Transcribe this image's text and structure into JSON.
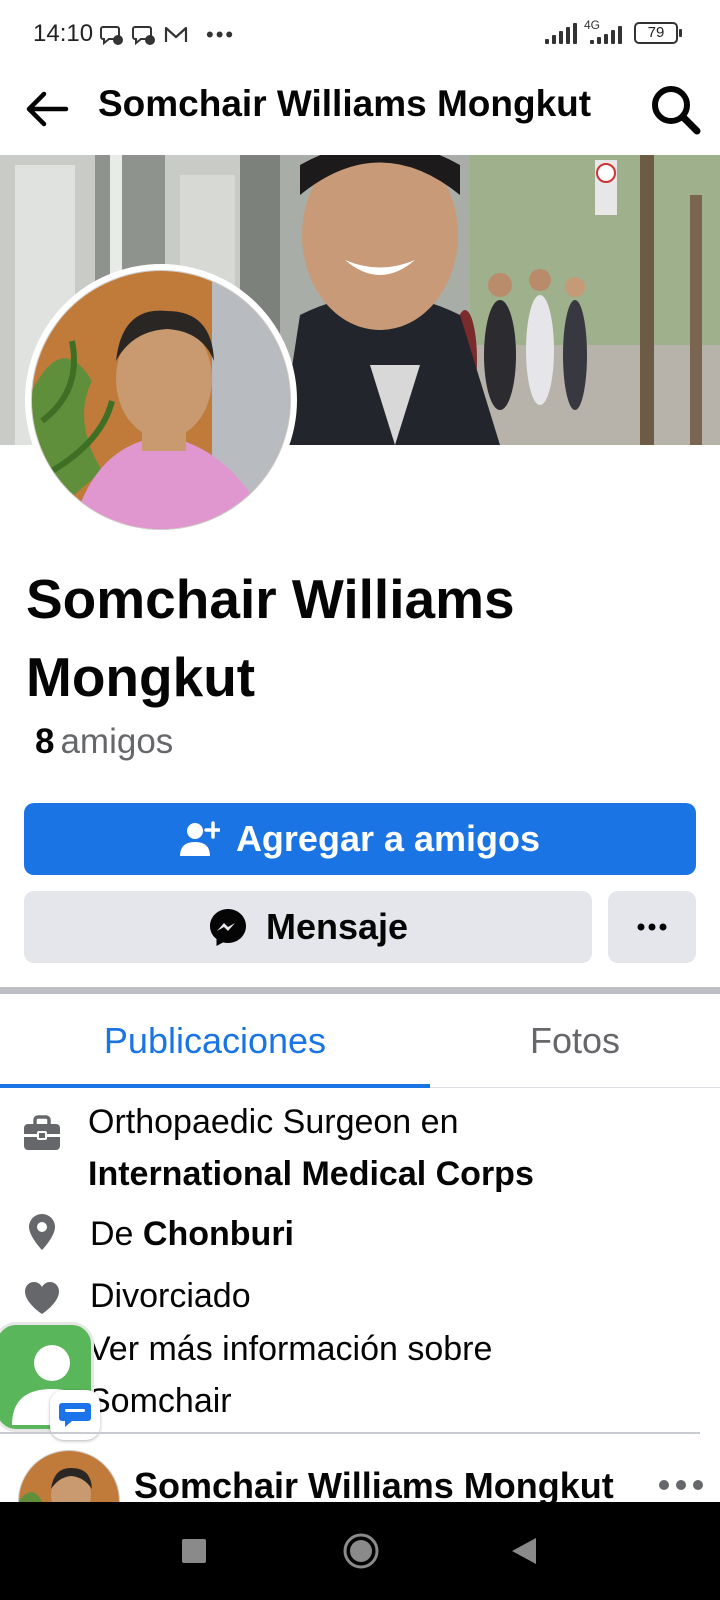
{
  "status_bar": {
    "time": "14:10",
    "network": "4G",
    "battery": "79"
  },
  "nav": {
    "title": "Somchair Williams Mongkut"
  },
  "profile": {
    "name": "Somchair Williams Mongkut",
    "friends_count": "8",
    "friends_label": "amigos"
  },
  "actions": {
    "add_friend": "Agregar a amigos",
    "message": "Mensaje"
  },
  "tabs": [
    {
      "label": "Publicaciones",
      "active": true
    },
    {
      "label": "Fotos",
      "active": false
    }
  ],
  "intro": {
    "work_prefix": "Orthopaedic Surgeon en",
    "work_place": "International Medical Corps",
    "from_prefix": "De",
    "from_place": "Chonburi",
    "relationship": "Divorciado",
    "more_line1": "Ver más información sobre",
    "more_line2": "Somchair"
  },
  "post": {
    "author": "Somchair Williams Mongkut"
  },
  "colors": {
    "accent": "#1b74e4",
    "button_gray": "#e4e6eb",
    "secondary_text": "#65676b"
  }
}
